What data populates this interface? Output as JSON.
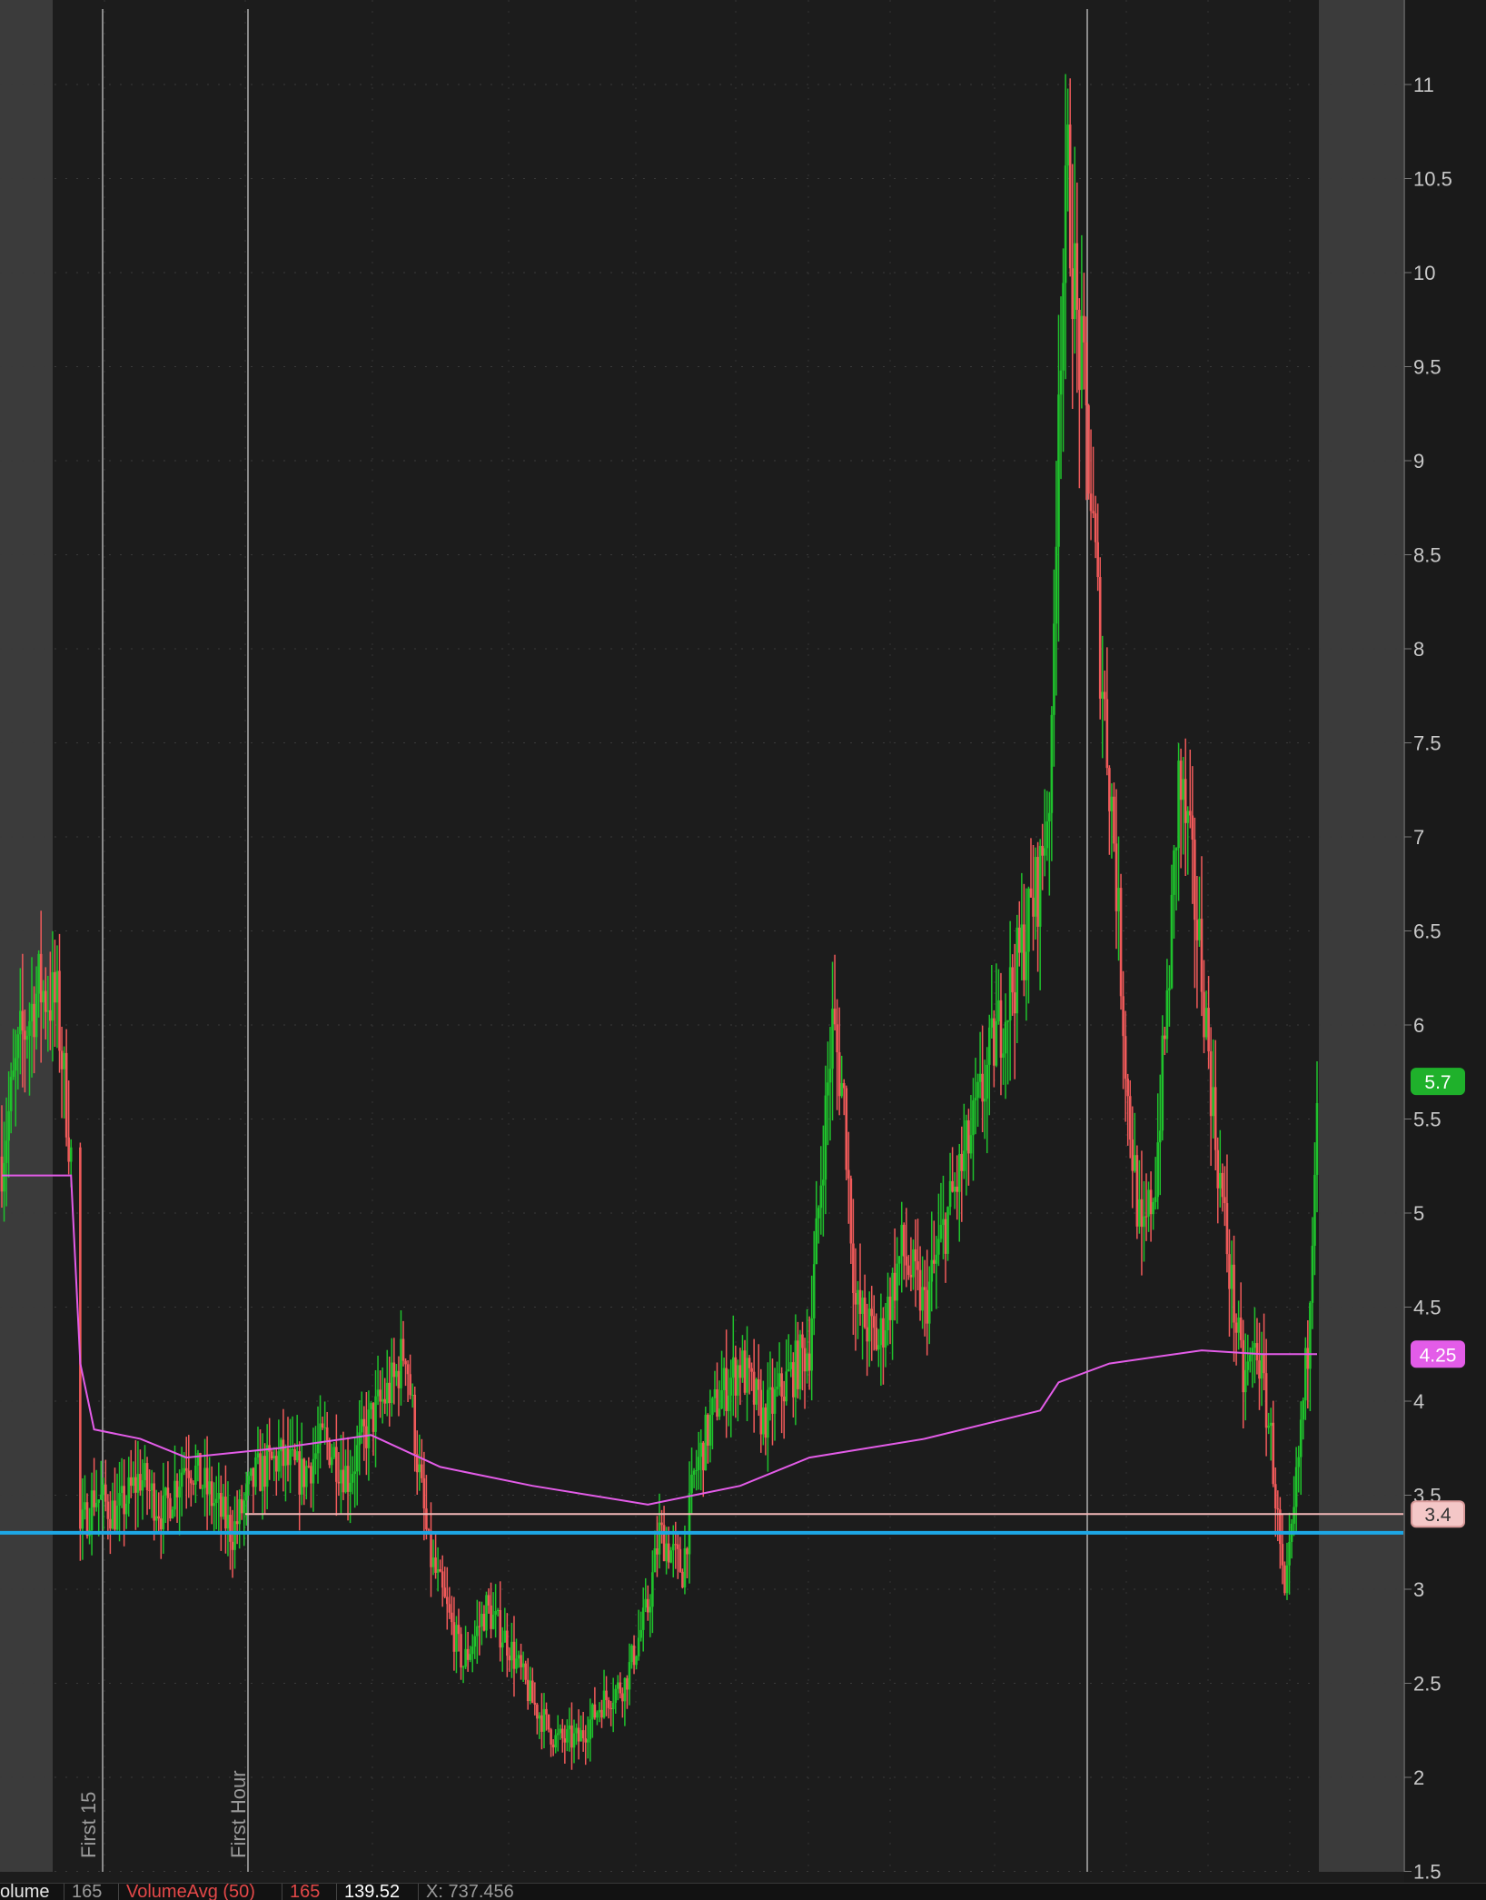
{
  "chart_data": {
    "type": "candlestick",
    "y_axis": {
      "ticks": [
        "11",
        "10.5",
        "10",
        "9.5",
        "9",
        "8.5",
        "8",
        "7.5",
        "7",
        "6.5",
        "6",
        "5.5",
        "5",
        "4.5",
        "4",
        "3.5",
        "3",
        "2.5",
        "2",
        "1.5"
      ],
      "range": [
        1.5,
        11
      ]
    },
    "session_markers": [
      "First 15",
      "First Hour"
    ],
    "price_badges": {
      "last": "5.7",
      "vwap": "4.25",
      "level": "3.4"
    },
    "horizontal_lines": {
      "level_3_4": 3.4,
      "support": 3.3
    },
    "colors": {
      "up": "#1fc22c",
      "down": "#f05a5a",
      "vwap": "#e35ce8",
      "support": "#1da7e6",
      "level": "#f2b8b8",
      "extended_hours": "#3b3b3b",
      "background": "#1c1c1c"
    },
    "price_path": [
      [
        0,
        5.3
      ],
      [
        8,
        5.9
      ],
      [
        16,
        6.2
      ],
      [
        24,
        6.1
      ],
      [
        30,
        5.3
      ],
      [
        34,
        3.3
      ],
      [
        40,
        3.5
      ],
      [
        50,
        3.4
      ],
      [
        60,
        3.6
      ],
      [
        70,
        3.4
      ],
      [
        80,
        3.7
      ],
      [
        90,
        3.5
      ],
      [
        100,
        3.3
      ],
      [
        110,
        3.6
      ],
      [
        120,
        3.7
      ],
      [
        130,
        3.6
      ],
      [
        140,
        3.8
      ],
      [
        150,
        3.6
      ],
      [
        160,
        3.9
      ],
      [
        170,
        4.1
      ],
      [
        175,
        4.3
      ],
      [
        180,
        3.7
      ],
      [
        185,
        3.2
      ],
      [
        190,
        3.0
      ],
      [
        200,
        2.6
      ],
      [
        210,
        2.9
      ],
      [
        220,
        2.7
      ],
      [
        230,
        2.4
      ],
      [
        240,
        2.2
      ],
      [
        250,
        2.2
      ],
      [
        260,
        2.4
      ],
      [
        270,
        2.5
      ],
      [
        280,
        2.9
      ],
      [
        285,
        3.3
      ],
      [
        295,
        3.1
      ],
      [
        300,
        3.6
      ],
      [
        310,
        4.0
      ],
      [
        320,
        4.2
      ],
      [
        330,
        3.9
      ],
      [
        340,
        4.1
      ],
      [
        350,
        4.3
      ],
      [
        355,
        5.2
      ],
      [
        360,
        6.0
      ],
      [
        365,
        5.6
      ],
      [
        370,
        4.5
      ],
      [
        380,
        4.3
      ],
      [
        390,
        4.8
      ],
      [
        400,
        4.5
      ],
      [
        410,
        5.0
      ],
      [
        420,
        5.4
      ],
      [
        430,
        5.9
      ],
      [
        440,
        6.3
      ],
      [
        450,
        6.8
      ],
      [
        455,
        7.4
      ],
      [
        458,
        9.5
      ],
      [
        462,
        10.5
      ],
      [
        466,
        9.7
      ],
      [
        470,
        9.2
      ],
      [
        476,
        8.0
      ],
      [
        482,
        7.0
      ],
      [
        488,
        5.6
      ],
      [
        494,
        4.8
      ],
      [
        500,
        5.2
      ],
      [
        506,
        6.3
      ],
      [
        510,
        7.3
      ],
      [
        514,
        7.0
      ],
      [
        520,
        6.3
      ],
      [
        526,
        5.4
      ],
      [
        532,
        4.7
      ],
      [
        538,
        4.1
      ],
      [
        544,
        4.3
      ],
      [
        550,
        3.8
      ],
      [
        556,
        2.9
      ],
      [
        560,
        3.4
      ],
      [
        566,
        4.3
      ],
      [
        570,
        5.7
      ]
    ],
    "vwap_path": [
      [
        0,
        5.2
      ],
      [
        30,
        5.2
      ],
      [
        34,
        4.2
      ],
      [
        40,
        3.85
      ],
      [
        60,
        3.8
      ],
      [
        80,
        3.7
      ],
      [
        120,
        3.75
      ],
      [
        160,
        3.82
      ],
      [
        190,
        3.65
      ],
      [
        230,
        3.55
      ],
      [
        280,
        3.45
      ],
      [
        320,
        3.55
      ],
      [
        350,
        3.7
      ],
      [
        400,
        3.8
      ],
      [
        450,
        3.95
      ],
      [
        458,
        4.1
      ],
      [
        480,
        4.2
      ],
      [
        520,
        4.27
      ],
      [
        546,
        4.25
      ],
      [
        570,
        4.25
      ]
    ]
  },
  "status_bar": {
    "study_label": "olume",
    "volume_value": "165",
    "avg_label": "VolumeAvg (50)",
    "avg_value": "165",
    "value3": "139.52",
    "x_value": "X: 737.456"
  }
}
